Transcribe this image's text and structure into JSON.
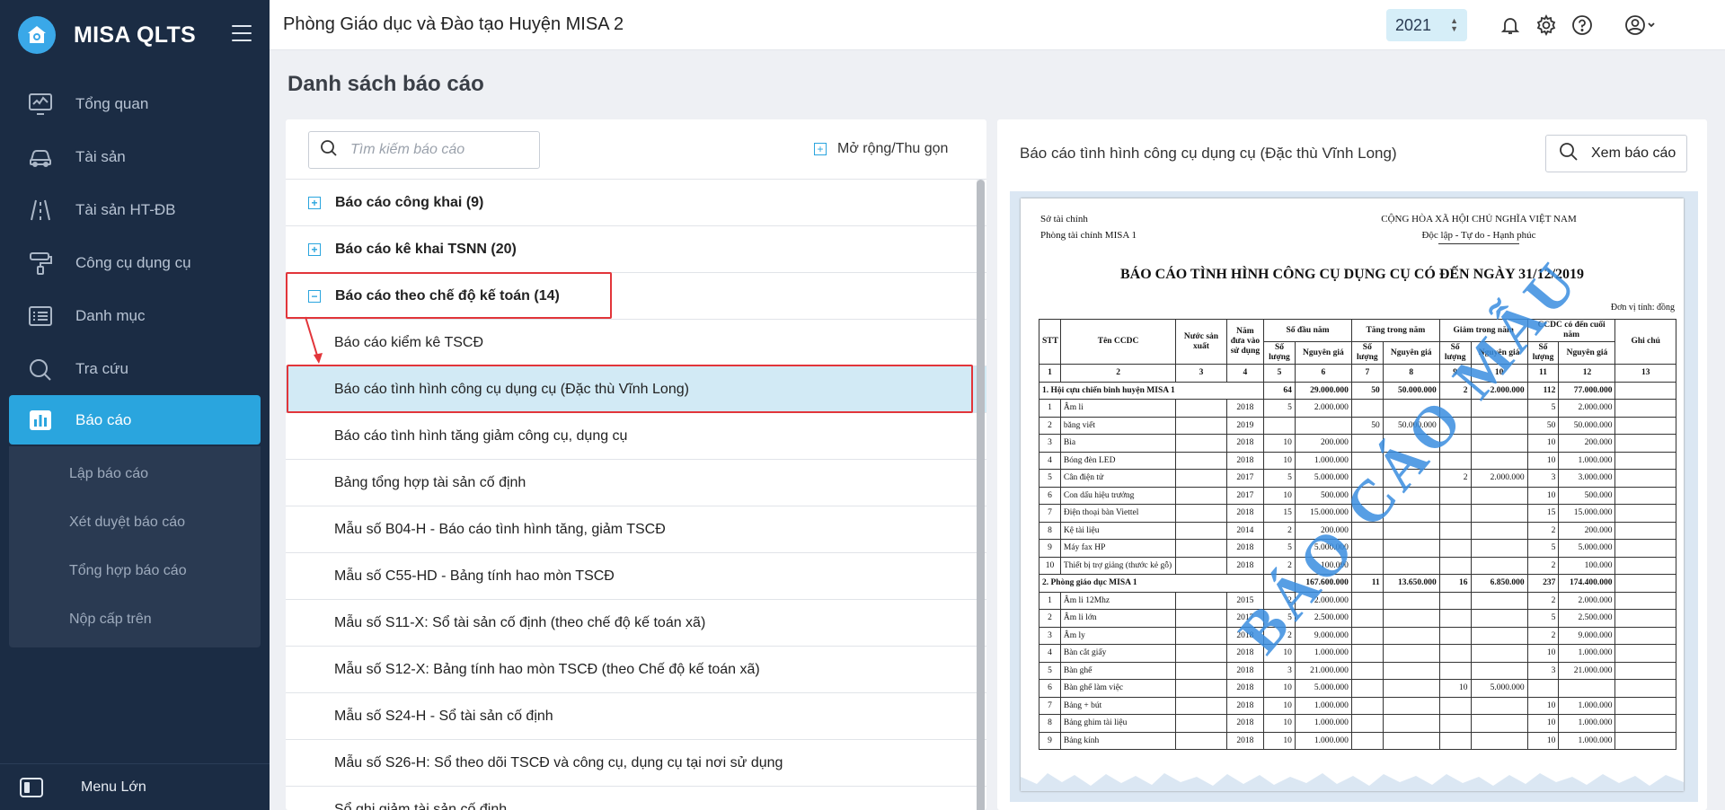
{
  "app": {
    "name": "MISA QLTS"
  },
  "sidebar": {
    "items": [
      {
        "label": "Tổng quan",
        "icon": "dashboard-icon"
      },
      {
        "label": "Tài sản",
        "icon": "car-icon"
      },
      {
        "label": "Tài sản HT-ĐB",
        "icon": "road-icon"
      },
      {
        "label": "Công cụ dụng cụ",
        "icon": "paint-roller-icon"
      },
      {
        "label": "Danh mục",
        "icon": "list-icon"
      },
      {
        "label": "Tra cứu",
        "icon": "search-icon"
      },
      {
        "label": "Báo cáo",
        "icon": "chart-icon",
        "active": true
      }
    ],
    "subitems": [
      {
        "label": "Lập báo cáo"
      },
      {
        "label": "Xét duyệt báo cáo"
      },
      {
        "label": "Tổng hợp báo cáo"
      },
      {
        "label": "Nộp cấp trên"
      }
    ],
    "bottom_label": "Menu Lớn"
  },
  "header": {
    "org_title": "Phòng Giáo dục và Đào tạo Huyện MISA 2",
    "year": "2021"
  },
  "page": {
    "title": "Danh sách báo cáo"
  },
  "left": {
    "search_placeholder": "Tìm kiếm báo cáo",
    "expand_label": "Mở rộng/Thu gọn",
    "groups": [
      {
        "label": "Báo cáo công khai (9)",
        "expanded": false
      },
      {
        "label": "Báo cáo kê khai TSNN (20)",
        "expanded": false
      },
      {
        "label": "Báo cáo theo chế độ kế toán (14)",
        "expanded": true
      }
    ],
    "children": [
      {
        "label": "Báo cáo kiểm kê TSCĐ"
      },
      {
        "label": "Báo cáo tình hình công cụ dụng cụ (Đặc thù Vĩnh Long)",
        "selected": true
      },
      {
        "label": "Báo cáo tình hình tăng giảm công cụ, dụng cụ"
      },
      {
        "label": "Bảng tổng hợp tài sản cố định"
      },
      {
        "label": "Mẫu số B04-H - Báo cáo tình hình tăng, giảm TSCĐ"
      },
      {
        "label": "Mẫu số C55-HD - Bảng tính hao mòn TSCĐ"
      },
      {
        "label": "Mẫu số S11-X: Sổ tài sản cố định (theo chế độ kế toán xã)"
      },
      {
        "label": "Mẫu số S12-X: Bảng tính hao mòn TSCĐ (theo Chế độ kế toán xã)"
      },
      {
        "label": "Mẫu số S24-H - Sổ tài sản cố định"
      },
      {
        "label": "Mẫu số S26-H: Sổ theo dõi TSCĐ và công cụ, dụng cụ tại nơi sử dụng"
      },
      {
        "label": "Sổ ghi giảm tài sản cố định"
      }
    ]
  },
  "right": {
    "title": "Báo cáo tình hình công cụ dụng cụ (Đặc thù Vĩnh Long)",
    "view_button": "Xem báo cáo",
    "doc": {
      "org_line1": "Sở tài chính",
      "org_line2": "Phòng tài chính MISA 1",
      "nation_line1": "CỘNG HÒA XÃ HỘI CHỦ NGHĨA VIỆT NAM",
      "nation_line2": "Độc lập - Tự do - Hạnh phúc",
      "title": "BÁO CÁO TÌNH HÌNH CÔNG CỤ DỤNG CỤ CÓ ĐẾN NGÀY 31/12/2019",
      "unit": "Đơn vị tính: đồng",
      "watermark": "BÁO CÁO MẪU",
      "headers": {
        "stt": "STT",
        "ten": "Tên CCDC",
        "nuoc": "Nước sản xuất",
        "nam": "Năm đưa vào sử dụng",
        "dau_nam": "Số đầu năm",
        "tang": "Tăng trong năm",
        "giam": "Giảm trong năm",
        "cuoi_nam": "CCDC có đến cuối năm",
        "so_luong": "Số lượng",
        "nguyen_gia": "Nguyên giá",
        "ghi_chu": "Ghi chú"
      },
      "col_numbers": [
        "1",
        "2",
        "3",
        "4",
        "5",
        "6",
        "7",
        "8",
        "9",
        "10",
        "11",
        "12",
        "13"
      ],
      "rows": [
        {
          "group": true,
          "cells": [
            "1. Hội cựu chiến binh huyện MISA 1",
            "",
            "",
            "",
            "64",
            "29.000.000",
            "50",
            "50.000.000",
            "2",
            "2.000.000",
            "112",
            "77.000.000",
            ""
          ]
        },
        {
          "cells": [
            "1",
            "Âm li",
            "",
            "2018",
            "5",
            "2.000.000",
            "",
            "",
            "",
            "",
            "5",
            "2.000.000",
            ""
          ]
        },
        {
          "cells": [
            "2",
            "băng viết",
            "",
            "2019",
            "",
            "",
            "50",
            "50.000.000",
            "",
            "",
            "50",
            "50.000.000",
            ""
          ]
        },
        {
          "cells": [
            "3",
            "Bìa",
            "",
            "2018",
            "10",
            "200.000",
            "",
            "",
            "",
            "",
            "10",
            "200.000",
            ""
          ]
        },
        {
          "cells": [
            "4",
            "Bóng đèn LED",
            "",
            "2018",
            "10",
            "1.000.000",
            "",
            "",
            "",
            "",
            "10",
            "1.000.000",
            ""
          ]
        },
        {
          "cells": [
            "5",
            "Cân điện tử",
            "",
            "2017",
            "5",
            "5.000.000",
            "",
            "",
            "2",
            "2.000.000",
            "3",
            "3.000.000",
            ""
          ]
        },
        {
          "cells": [
            "6",
            "Con dấu hiệu trưởng",
            "",
            "2017",
            "10",
            "500.000",
            "",
            "",
            "",
            "",
            "10",
            "500.000",
            ""
          ]
        },
        {
          "cells": [
            "7",
            "Điện thoại bàn Viettel",
            "",
            "2018",
            "15",
            "15.000.000",
            "",
            "",
            "",
            "",
            "15",
            "15.000.000",
            ""
          ]
        },
        {
          "cells": [
            "8",
            "Kệ tài liệu",
            "",
            "2014",
            "2",
            "200.000",
            "",
            "",
            "",
            "",
            "2",
            "200.000",
            ""
          ]
        },
        {
          "cells": [
            "9",
            "Máy fax HP",
            "",
            "2018",
            "5",
            "5.000.000",
            "",
            "",
            "",
            "",
            "5",
            "5.000.000",
            ""
          ]
        },
        {
          "cells": [
            "10",
            "Thiết bị trợ giảng (thước kẻ gỗ)",
            "",
            "2018",
            "2",
            "100.000",
            "",
            "",
            "",
            "",
            "2",
            "100.000",
            ""
          ]
        },
        {
          "group": true,
          "cells": [
            "2. Phòng giáo dục MISA 1",
            "",
            "",
            "",
            "",
            "167.600.000",
            "11",
            "13.650.000",
            "16",
            "6.850.000",
            "237",
            "174.400.000",
            ""
          ]
        },
        {
          "cells": [
            "1",
            "Âm li 12Mhz",
            "",
            "2015",
            "2",
            "2.000.000",
            "",
            "",
            "",
            "",
            "2",
            "2.000.000",
            ""
          ]
        },
        {
          "cells": [
            "2",
            "Âm li lớn",
            "",
            "2017",
            "5",
            "2.500.000",
            "",
            "",
            "",
            "",
            "5",
            "2.500.000",
            ""
          ]
        },
        {
          "cells": [
            "3",
            "Âm ly",
            "",
            "2018",
            "2",
            "9.000.000",
            "",
            "",
            "",
            "",
            "2",
            "9.000.000",
            ""
          ]
        },
        {
          "cells": [
            "4",
            "Bàn cắt giấy",
            "",
            "2018",
            "10",
            "1.000.000",
            "",
            "",
            "",
            "",
            "10",
            "1.000.000",
            ""
          ]
        },
        {
          "cells": [
            "5",
            "Bàn ghế",
            "",
            "2018",
            "3",
            "21.000.000",
            "",
            "",
            "",
            "",
            "3",
            "21.000.000",
            ""
          ]
        },
        {
          "cells": [
            "6",
            "Bàn ghế làm việc",
            "",
            "2018",
            "10",
            "5.000.000",
            "",
            "",
            "10",
            "5.000.000",
            "",
            "",
            ""
          ]
        },
        {
          "cells": [
            "7",
            "Bảng + bút",
            "",
            "2018",
            "10",
            "1.000.000",
            "",
            "",
            "",
            "",
            "10",
            "1.000.000",
            ""
          ]
        },
        {
          "cells": [
            "8",
            "Bảng ghim tài liệu",
            "",
            "2018",
            "10",
            "1.000.000",
            "",
            "",
            "",
            "",
            "10",
            "1.000.000",
            ""
          ]
        },
        {
          "cells": [
            "9",
            "Bảng kính",
            "",
            "2018",
            "10",
            "1.000.000",
            "",
            "",
            "",
            "",
            "10",
            "1.000.000",
            ""
          ]
        }
      ]
    }
  },
  "colors": {
    "sidebar_bg": "#1b2c44",
    "accent": "#2aa5de",
    "selected_row": "#d2eaf5",
    "highlight": "#e2353a",
    "watermark": "#3a8ee0"
  }
}
